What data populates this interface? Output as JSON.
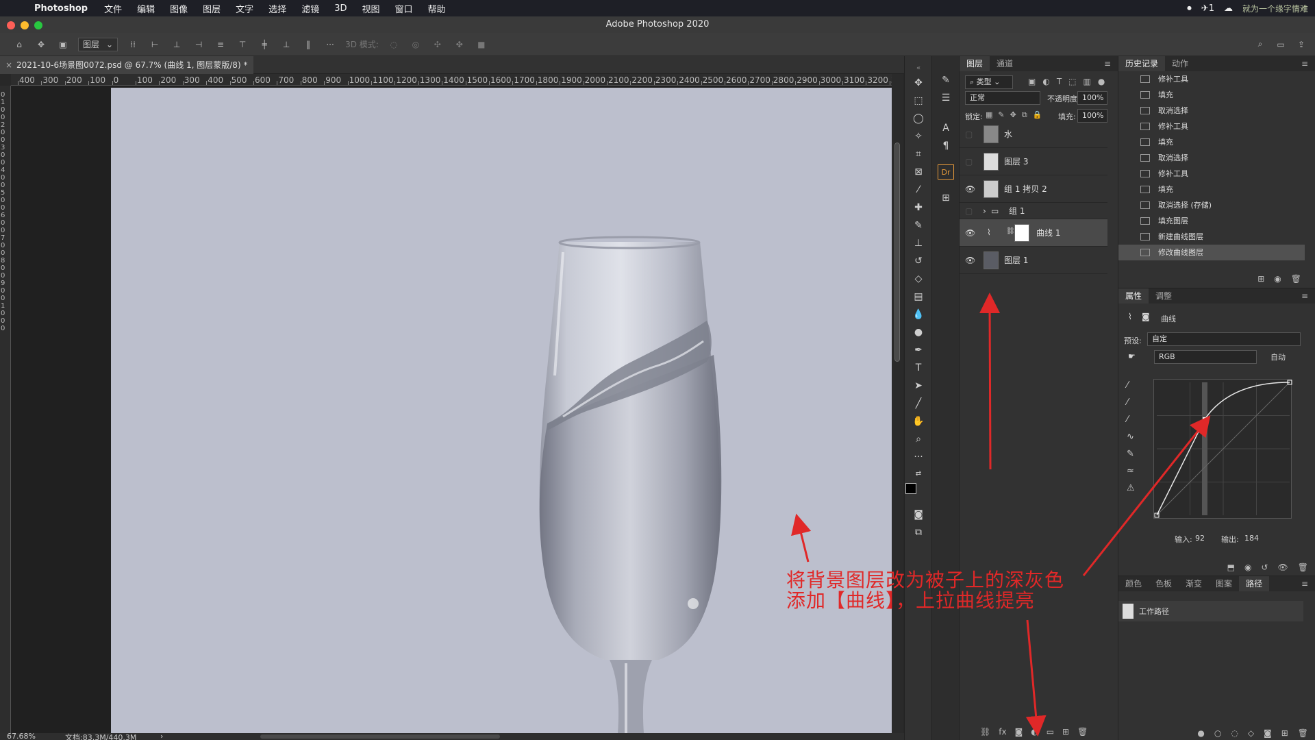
{
  "menubar": {
    "app": "Photoshop",
    "items": [
      "文件",
      "编辑",
      "图像",
      "图层",
      "文字",
      "选择",
      "滤镜",
      "3D",
      "视图",
      "窗口",
      "帮助"
    ],
    "right_badge": "1",
    "watermark": "就为一个缘字情难"
  },
  "window": {
    "title": "Adobe Photoshop 2020"
  },
  "options": {
    "auto_select": "图层",
    "mode3d": "3D 模式:"
  },
  "document": {
    "tab_title": "2021-10-6场景图0072.psd @ 67.7% (曲线 1, 图层蒙版/8) *"
  },
  "ruler": {
    "h_labels": [
      "400",
      "300",
      "200",
      "100",
      "0",
      "100",
      "200",
      "300",
      "400",
      "500",
      "600",
      "700",
      "800",
      "900",
      "1000",
      "1100",
      "1200",
      "1300",
      "1400",
      "1500",
      "1600",
      "1700",
      "1800",
      "1900",
      "2000",
      "2100",
      "2200",
      "2300",
      "2400",
      "2500",
      "2600",
      "2700",
      "2800",
      "2900",
      "3000",
      "3100",
      "3200",
      "330"
    ],
    "v_labels": [
      "0",
      "1",
      "0",
      "0",
      "2",
      "0",
      "0",
      "3",
      "0",
      "0",
      "4",
      "0",
      "0",
      "5",
      "0",
      "0",
      "6",
      "0",
      "0",
      "7",
      "0",
      "0",
      "8",
      "0",
      "0",
      "9",
      "0",
      "0",
      "1",
      "0",
      "0",
      "0"
    ]
  },
  "status": {
    "zoom": "67.68%",
    "doc": "文档:83.3M/440.3M"
  },
  "layers_panel": {
    "tabs": [
      "图层",
      "通道"
    ],
    "filter_label": "类型",
    "blend_mode": "正常",
    "opacity_label": "不透明度:",
    "opacity": "100%",
    "lock_label": "锁定:",
    "fill_label": "填充:",
    "fill": "100%",
    "layers": [
      {
        "name": "水",
        "visible": false
      },
      {
        "name": "图层 3",
        "visible": false
      },
      {
        "name": "组 1 拷贝 2",
        "visible": true
      },
      {
        "name": "组 1",
        "visible": false
      },
      {
        "name": "曲线 1",
        "visible": true
      },
      {
        "name": "图层 1",
        "visible": true
      }
    ]
  },
  "history_panel": {
    "tabs": [
      "历史记录",
      "动作"
    ],
    "items": [
      "修补工具",
      "填充",
      "取消选择",
      "修补工具",
      "填充",
      "取消选择",
      "修补工具",
      "填充",
      "取消选择 (存储)",
      "填充图层",
      "新建曲线图层",
      "修改曲线图层"
    ],
    "selected_index": 11
  },
  "properties_panel": {
    "tabs": [
      "属性",
      "调整"
    ],
    "title": "曲线",
    "preset_label": "预设:",
    "preset": "自定",
    "channel": "RGB",
    "auto_label": "自动",
    "input_label": "输入:",
    "input": "92",
    "output_label": "输出:",
    "output": "184"
  },
  "paths_panel": {
    "tabs": [
      "颜色",
      "色板",
      "渐变",
      "图案",
      "路径"
    ],
    "item": "工作路径"
  },
  "annotation": {
    "line1": "将背景图层改为被子上的深灰色",
    "line2": "添加【曲线】，上拉曲线提亮"
  },
  "colors": {
    "canvas_bg": "#bcbfcd",
    "annotation": "#e02828",
    "panel": "#323232"
  }
}
